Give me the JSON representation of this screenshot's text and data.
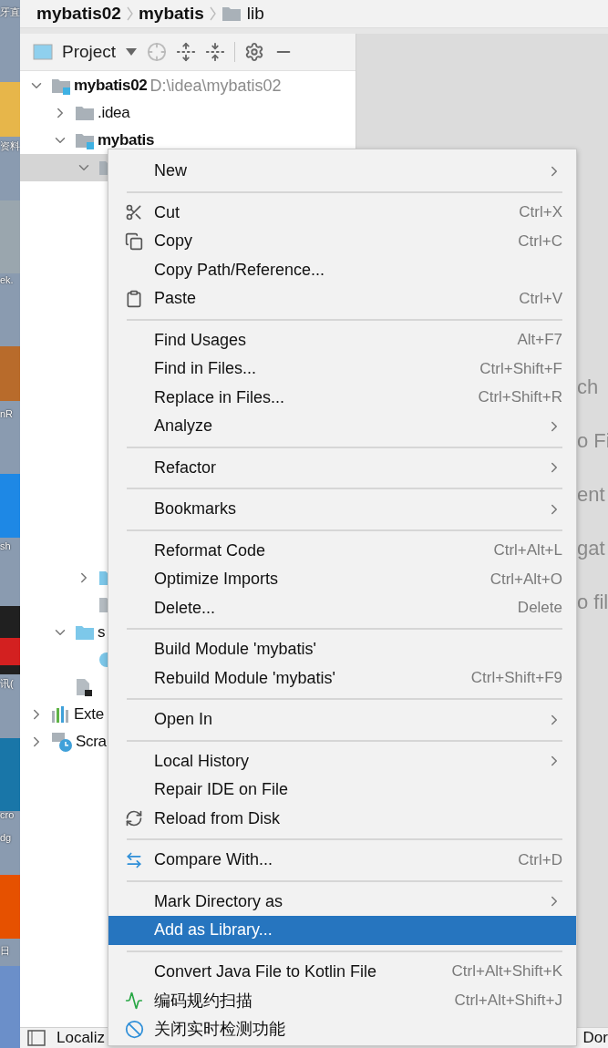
{
  "desktop": {
    "labels": [
      "牙直",
      "资料",
      "ek.",
      "nR",
      "sh",
      "讯(",
      "cro",
      "dg",
      "日"
    ]
  },
  "breadcrumb": [
    {
      "label": "mybatis02",
      "kind": "module"
    },
    {
      "label": "mybatis",
      "kind": "module"
    },
    {
      "label": "lib",
      "kind": "folder"
    }
  ],
  "project_toolbar": {
    "title": "Project"
  },
  "tree": [
    {
      "label": "mybatis02",
      "path": "D:\\idea\\mybatis02",
      "kind": "module",
      "expanded": true,
      "selected": false,
      "children": [
        {
          "label": ".idea",
          "kind": "folder",
          "expanded": false,
          "selected": false
        },
        {
          "label": "mybatis",
          "kind": "module",
          "expanded": true,
          "selected": false,
          "children": [
            {
              "kind": "folder",
              "expanded": true,
              "selected": true
            },
            {
              "kind": "source-folder",
              "expanded": false,
              "selected": false
            },
            {
              "kind": "file",
              "selected": false
            }
          ]
        },
        {
          "label": "s",
          "kind": "source-folder",
          "expanded": true,
          "selected": false,
          "children": [
            {
              "kind": "class",
              "selected": false
            }
          ]
        },
        {
          "kind": "pom",
          "selected": false
        }
      ]
    },
    {
      "label": "Exte",
      "kind": "libraries",
      "expanded": false,
      "selected": false
    },
    {
      "label": "Scra",
      "kind": "scratches",
      "expanded": false,
      "selected": false
    }
  ],
  "editor_hints": [
    "ch",
    "o Fi",
    "ent",
    "gat",
    "o fil"
  ],
  "context_menu": [
    {
      "kind": "plain",
      "label": "New",
      "submenu": true,
      "selected": false
    },
    {
      "kind": "separator"
    },
    {
      "kind": "cut",
      "label": "Cut",
      "shortcut": "Ctrl+X",
      "submenu": false,
      "selected": false
    },
    {
      "kind": "copy",
      "label": "Copy",
      "shortcut": "Ctrl+C",
      "submenu": false,
      "selected": false
    },
    {
      "kind": "plain",
      "label": "Copy Path/Reference...",
      "submenu": false,
      "selected": false
    },
    {
      "kind": "paste",
      "label": "Paste",
      "shortcut": "Ctrl+V",
      "submenu": false,
      "selected": false
    },
    {
      "kind": "separator"
    },
    {
      "kind": "plain",
      "label": "Find Usages",
      "shortcut": "Alt+F7",
      "submenu": false,
      "selected": false
    },
    {
      "kind": "plain",
      "label": "Find in Files...",
      "shortcut": "Ctrl+Shift+F",
      "submenu": false,
      "selected": false
    },
    {
      "kind": "plain",
      "label": "Replace in Files...",
      "shortcut": "Ctrl+Shift+R",
      "submenu": false,
      "selected": false
    },
    {
      "kind": "plain",
      "label": "Analyze",
      "submenu": true,
      "selected": false
    },
    {
      "kind": "separator"
    },
    {
      "kind": "plain",
      "label": "Refactor",
      "submenu": true,
      "selected": false
    },
    {
      "kind": "separator"
    },
    {
      "kind": "plain",
      "label": "Bookmarks",
      "submenu": true,
      "selected": false
    },
    {
      "kind": "separator"
    },
    {
      "kind": "plain",
      "label": "Reformat Code",
      "shortcut": "Ctrl+Alt+L",
      "submenu": false,
      "selected": false
    },
    {
      "kind": "plain",
      "label": "Optimize Imports",
      "shortcut": "Ctrl+Alt+O",
      "submenu": false,
      "selected": false
    },
    {
      "kind": "plain",
      "label": "Delete...",
      "shortcut": "Delete",
      "submenu": false,
      "selected": false
    },
    {
      "kind": "separator"
    },
    {
      "kind": "plain",
      "label": "Build Module 'mybatis'",
      "submenu": false,
      "selected": false
    },
    {
      "kind": "plain",
      "label": "Rebuild Module 'mybatis'",
      "shortcut": "Ctrl+Shift+F9",
      "submenu": false,
      "selected": false
    },
    {
      "kind": "separator"
    },
    {
      "kind": "plain",
      "label": "Open In",
      "submenu": true,
      "selected": false
    },
    {
      "kind": "separator"
    },
    {
      "kind": "plain",
      "label": "Local History",
      "submenu": true,
      "selected": false
    },
    {
      "kind": "plain",
      "label": "Repair IDE on File",
      "submenu": false,
      "selected": false
    },
    {
      "kind": "reload",
      "label": "Reload from Disk",
      "submenu": false,
      "selected": false
    },
    {
      "kind": "separator"
    },
    {
      "kind": "compare",
      "label": "Compare With...",
      "shortcut": "Ctrl+D",
      "submenu": false,
      "selected": false
    },
    {
      "kind": "separator"
    },
    {
      "kind": "plain",
      "label": "Mark Directory as",
      "submenu": true,
      "selected": false
    },
    {
      "kind": "plain",
      "label": "Add as Library...",
      "submenu": false,
      "selected": true
    },
    {
      "kind": "separator"
    },
    {
      "kind": "plain",
      "label": "Convert Java File to Kotlin File",
      "shortcut": "Ctrl+Alt+Shift+K",
      "submenu": false,
      "selected": false
    },
    {
      "kind": "scan",
      "label": "编码规约扫描",
      "shortcut": "Ctrl+Alt+Shift+J",
      "submenu": false,
      "selected": false
    },
    {
      "kind": "forbid",
      "label": "关闭实时检测功能",
      "submenu": false,
      "selected": false
    }
  ],
  "status_bar": {
    "left": "Localiz",
    "right": "Dor"
  }
}
